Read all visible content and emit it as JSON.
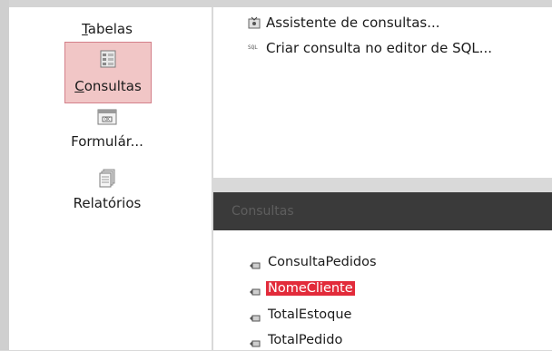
{
  "sidebar": {
    "items": [
      {
        "label": "Tabelas",
        "icon": "table-icon",
        "selected": false
      },
      {
        "label": "Consultas",
        "icon": "query-icon",
        "selected": true
      },
      {
        "label": "Formulár...",
        "icon": "form-icon",
        "selected": false
      },
      {
        "label": "Relatórios",
        "icon": "report-icon",
        "selected": false
      }
    ]
  },
  "tasks": {
    "items": [
      {
        "label": "Assistente de consultas...",
        "icon": "wizard-icon"
      },
      {
        "label": "Criar consulta no editor de SQL...",
        "icon": "sql-icon"
      }
    ]
  },
  "objects": {
    "header": "Consultas",
    "items": [
      {
        "label": "ConsultaPedidos",
        "selected": false
      },
      {
        "label": "NomeCliente",
        "selected": true
      },
      {
        "label": "TotalEstoque",
        "selected": false
      },
      {
        "label": "TotalPedido",
        "selected": false
      }
    ]
  },
  "colors": {
    "selected_sidebar_bg": "#f1c6c6",
    "selected_sidebar_border": "#d3808a",
    "selected_item_bg": "#e22b3a",
    "header_bg": "#3a3a3a"
  }
}
